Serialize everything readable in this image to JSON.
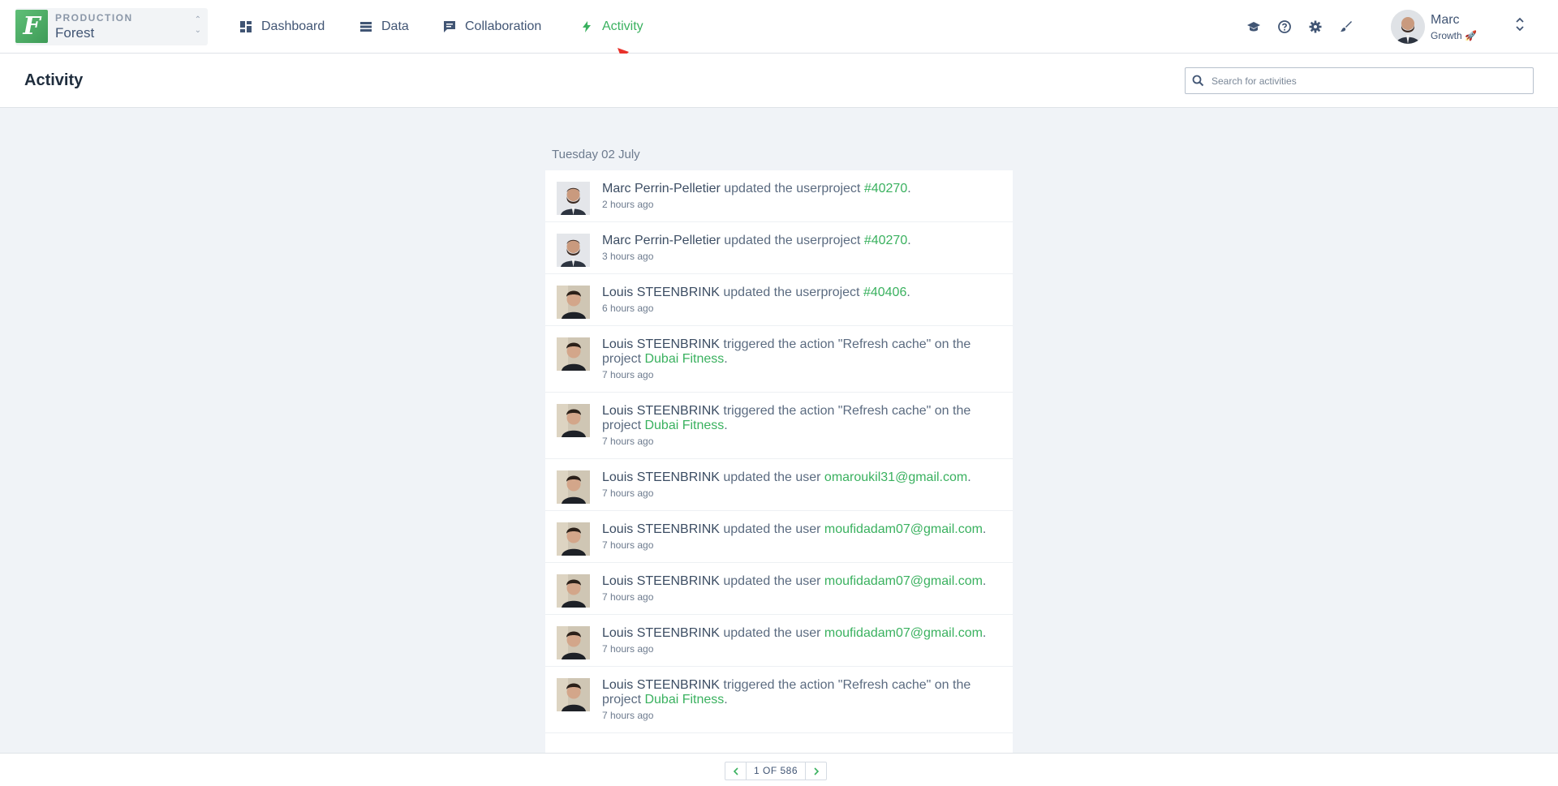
{
  "environment": {
    "label": "PRODUCTION",
    "name": "Forest",
    "logo_letter": "F"
  },
  "nav": [
    {
      "label": "Dashboard",
      "icon": "dashboard-icon"
    },
    {
      "label": "Data",
      "icon": "list-icon"
    },
    {
      "label": "Collaboration",
      "icon": "chat-icon"
    },
    {
      "label": "Activity",
      "icon": "bolt-icon",
      "active": true
    }
  ],
  "toolbar_icons": [
    "graduation-cap-icon",
    "help-icon",
    "gear-icon",
    "brush-icon"
  ],
  "profile": {
    "name": "Marc",
    "plan": "Growth 🚀"
  },
  "page": {
    "title": "Activity",
    "search_placeholder": "Search for activities"
  },
  "feed": {
    "date": "Tuesday 02 July",
    "items": [
      {
        "user": "Marc Perrin-Pelletier",
        "text": " updated the userproject ",
        "link": "#40270",
        "tail": ".",
        "time": "2 hours ago",
        "avatar": "marc"
      },
      {
        "user": "Marc Perrin-Pelletier",
        "text": " updated the userproject ",
        "link": "#40270",
        "tail": ".",
        "time": "3 hours ago",
        "avatar": "marc"
      },
      {
        "user": "Louis STEENBRINK",
        "text": " updated the userproject ",
        "link": "#40406",
        "tail": ".",
        "time": "6 hours ago",
        "avatar": "louis"
      },
      {
        "user": "Louis STEENBRINK",
        "text": " triggered the action \"Refresh cache\" on the project ",
        "link": "Dubai Fitness",
        "tail": ".",
        "time": "7 hours ago",
        "avatar": "louis"
      },
      {
        "user": "Louis STEENBRINK",
        "text": " triggered the action \"Refresh cache\" on the project ",
        "link": "Dubai Fitness",
        "tail": ".",
        "time": "7 hours ago",
        "avatar": "louis"
      },
      {
        "user": "Louis STEENBRINK",
        "text": " updated the user ",
        "link": "omaroukil31@gmail.com",
        "tail": ".",
        "time": "7 hours ago",
        "avatar": "louis"
      },
      {
        "user": "Louis STEENBRINK",
        "text": " updated the user ",
        "link": "moufidadam07@gmail.com",
        "tail": ".",
        "time": "7 hours ago",
        "avatar": "louis"
      },
      {
        "user": "Louis STEENBRINK",
        "text": " updated the user ",
        "link": "moufidadam07@gmail.com",
        "tail": ".",
        "time": "7 hours ago",
        "avatar": "louis"
      },
      {
        "user": "Louis STEENBRINK",
        "text": " updated the user ",
        "link": "moufidadam07@gmail.com",
        "tail": ".",
        "time": "7 hours ago",
        "avatar": "louis"
      },
      {
        "user": "Louis STEENBRINK",
        "text": " triggered the action \"Refresh cache\" on the project ",
        "link": "Dubai Fitness",
        "tail": ".",
        "time": "7 hours ago",
        "avatar": "louis"
      }
    ]
  },
  "pagination": {
    "text": "1 OF 586"
  },
  "colors": {
    "accent": "#3ab15f",
    "text": "#415574",
    "annotation": "#e8322b"
  }
}
